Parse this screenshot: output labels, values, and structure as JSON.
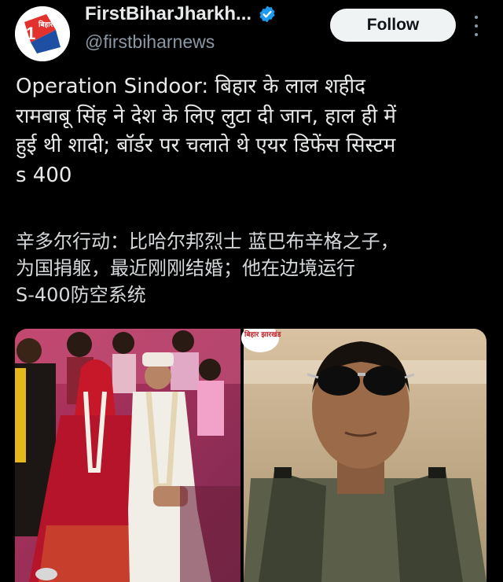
{
  "account": {
    "display_name": "FirstBiharJharkh...",
    "handle": "@firstbiharnews",
    "avatar_logo_text": "बिहार झारखंड",
    "verified_icon": "verified-badge-icon",
    "more_icon": "more-vertical-icon"
  },
  "follow_button": {
    "label": "Follow"
  },
  "tweet": {
    "text": "Operation Sindoor: बिहार के लाल शहीद\nरामबाबू सिंह ने देश के लिए लुटा दी जान, हाल ही में\nहुई थी शादी; बॉर्डर पर चलाते थे एयर डिफेंस सिस्टम\ns 400",
    "translation": "辛多尔行动：比哈尔邦烈士 蓝巴布辛格之子，\n为国捐躯，最近刚刚结婚；他在边境运行\nS-400防空系统"
  },
  "media": {
    "left_image": "wedding-photo",
    "right_image": "soldier-portrait",
    "logo_text": "बिहार झारखंड"
  },
  "colors": {
    "background": "#000000",
    "text": "#e7e9ea",
    "secondary_text": "#8b98a5",
    "verified": "#1d9bf0",
    "follow_bg": "#eff3f4"
  }
}
